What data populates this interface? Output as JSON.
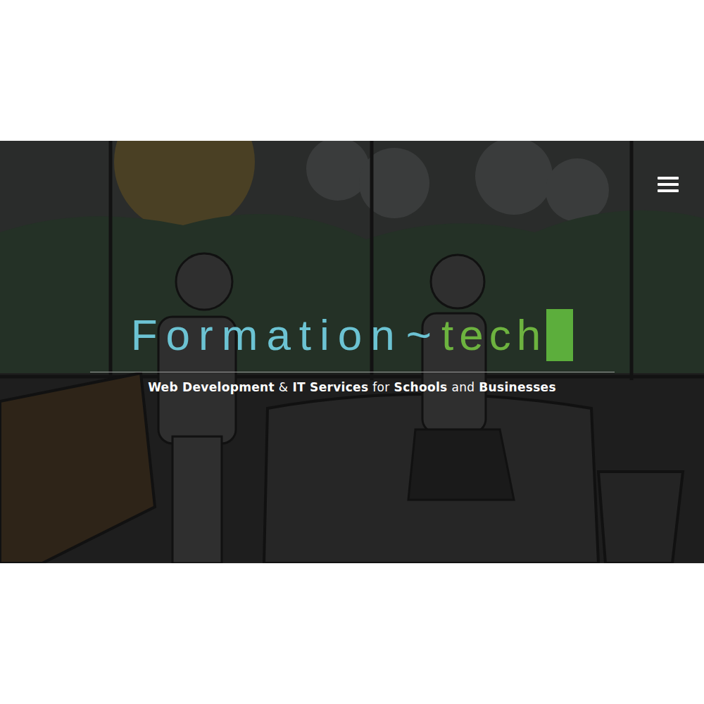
{
  "hero": {
    "title": {
      "main": "Formation",
      "separator": "~",
      "accent": "tech"
    },
    "tagline": [
      {
        "text": "Web Development",
        "bold": true
      },
      {
        "text": "&",
        "bold": false
      },
      {
        "text": "IT Services",
        "bold": true
      },
      {
        "text": "for",
        "bold": false
      },
      {
        "text": "Schools",
        "bold": true
      },
      {
        "text": "and",
        "bold": false
      },
      {
        "text": "Businesses",
        "bold": true
      }
    ]
  }
}
